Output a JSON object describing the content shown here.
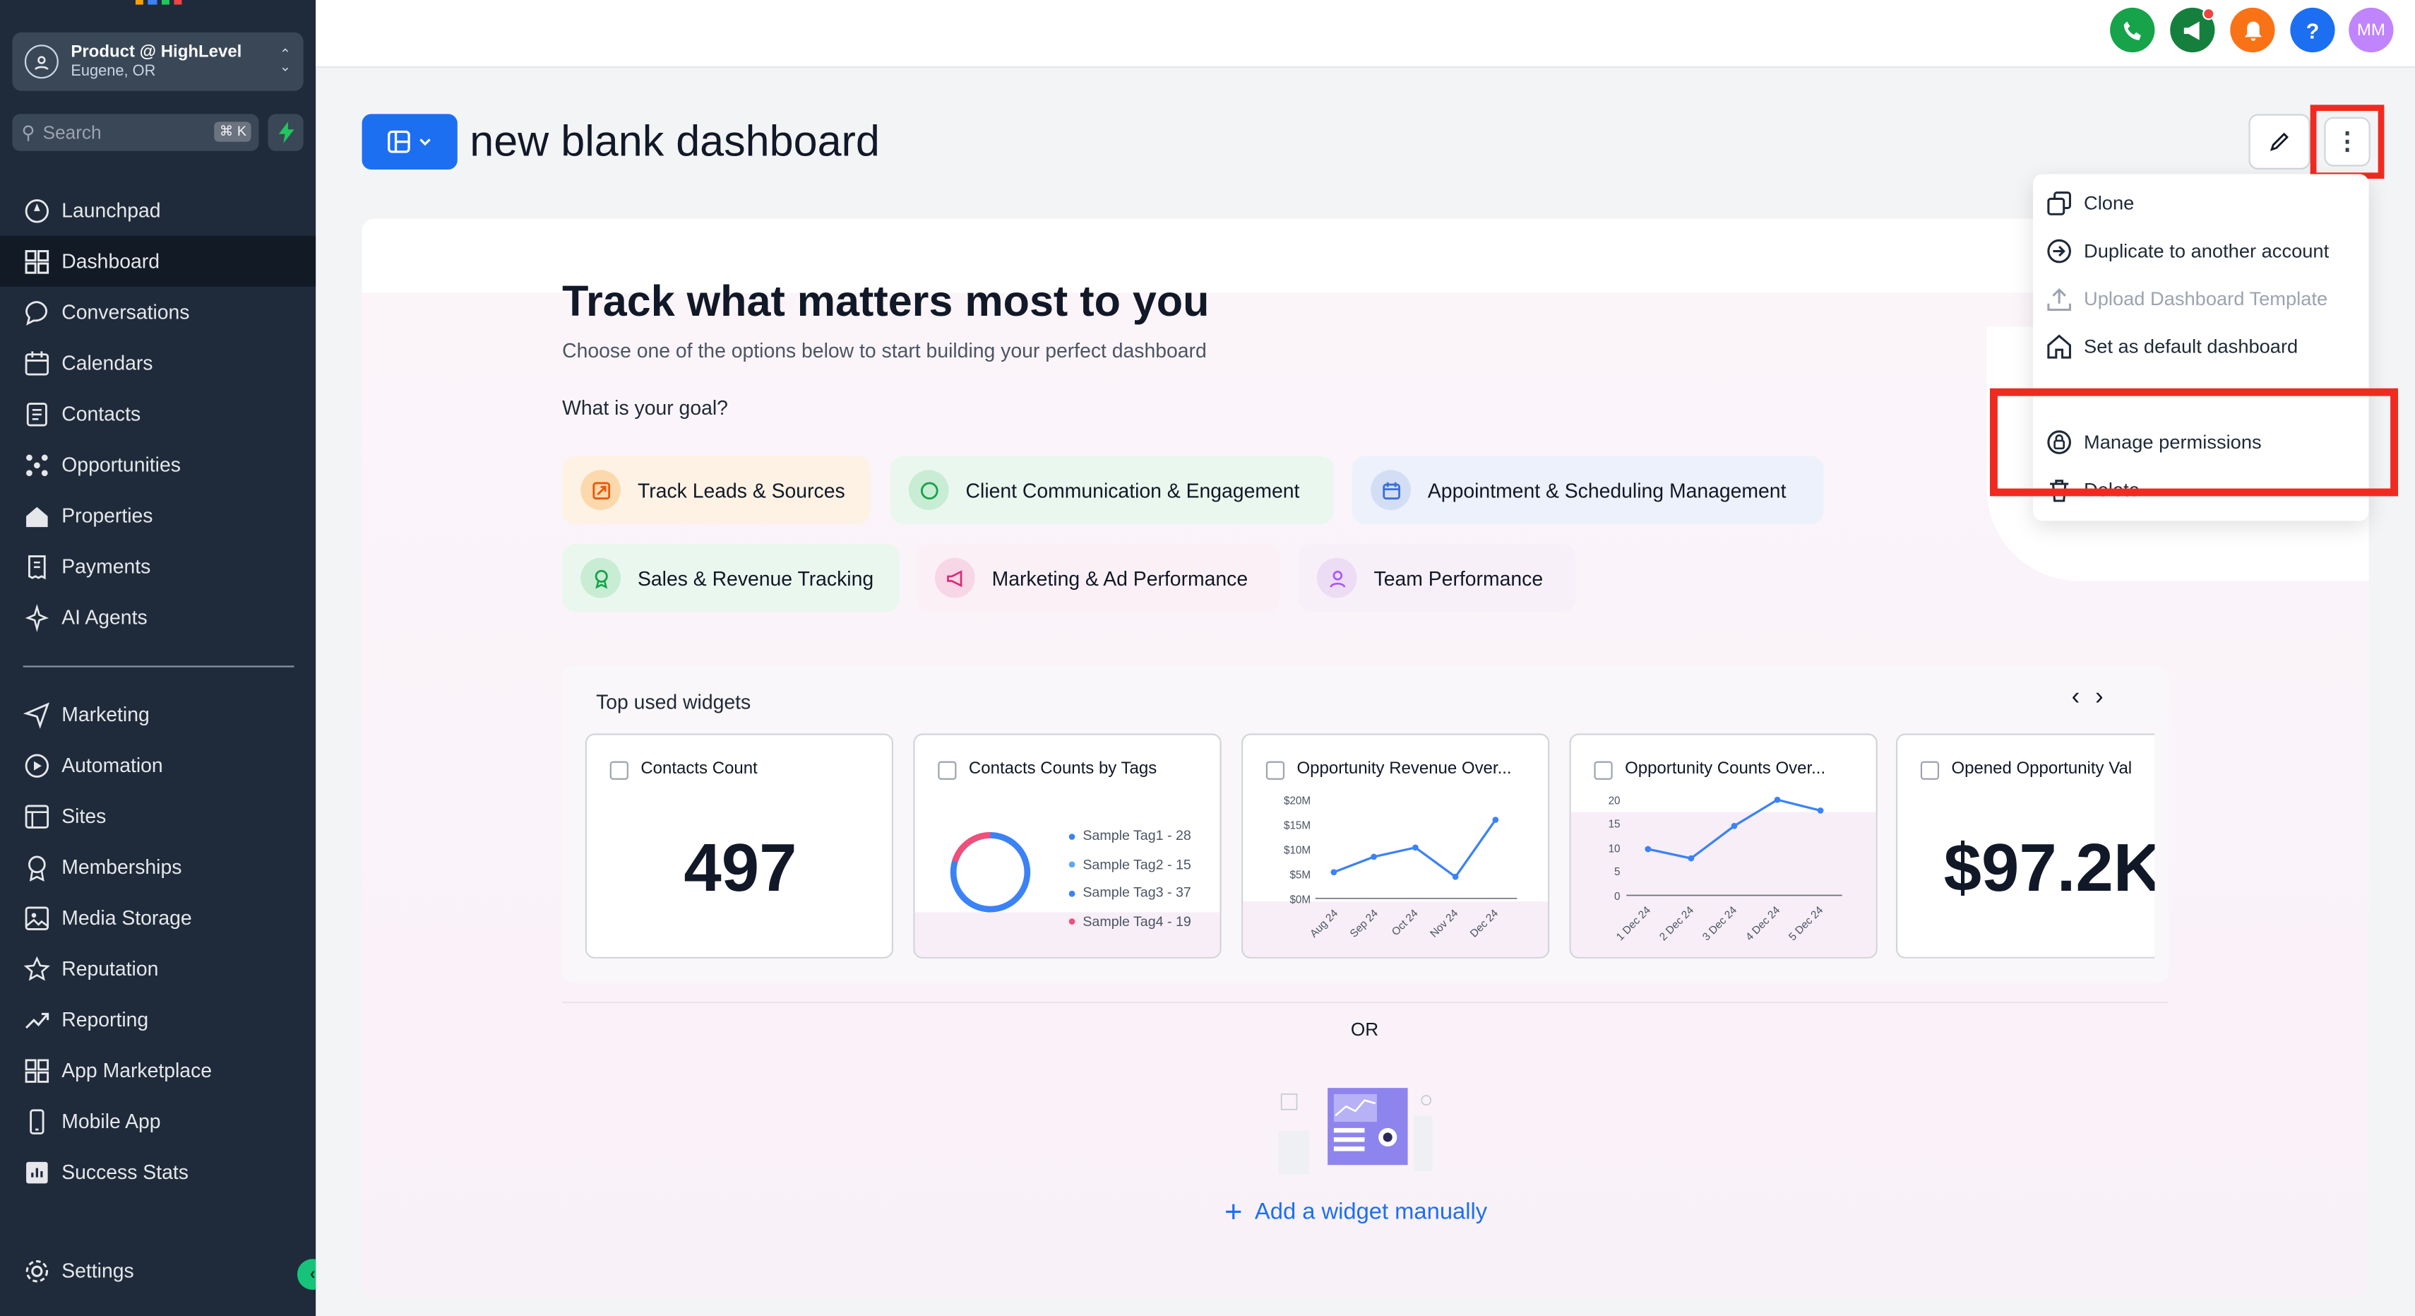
{
  "account": {
    "name": "Product @ HighLevel",
    "location": "Eugene, OR"
  },
  "search": {
    "placeholder": "Search",
    "shortcut": "⌘ K"
  },
  "sidebar": {
    "items": [
      {
        "label": "Launchpad",
        "icon": "rocket-icon"
      },
      {
        "label": "Dashboard",
        "icon": "grid-icon",
        "active": true
      },
      {
        "label": "Conversations",
        "icon": "chat-icon"
      },
      {
        "label": "Calendars",
        "icon": "calendar-icon"
      },
      {
        "label": "Contacts",
        "icon": "contacts-icon"
      },
      {
        "label": "Opportunities",
        "icon": "opportunities-icon"
      },
      {
        "label": "Properties",
        "icon": "home-icon"
      },
      {
        "label": "Payments",
        "icon": "receipt-icon"
      },
      {
        "label": "AI Agents",
        "icon": "sparkle-icon"
      }
    ],
    "items2": [
      {
        "label": "Marketing",
        "icon": "send-icon"
      },
      {
        "label": "Automation",
        "icon": "automation-icon"
      },
      {
        "label": "Sites",
        "icon": "sites-icon"
      },
      {
        "label": "Memberships",
        "icon": "award-icon"
      },
      {
        "label": "Media Storage",
        "icon": "image-icon"
      },
      {
        "label": "Reputation",
        "icon": "star-icon"
      },
      {
        "label": "Reporting",
        "icon": "trend-icon"
      },
      {
        "label": "App Marketplace",
        "icon": "apps-icon"
      },
      {
        "label": "Mobile App",
        "icon": "phone-icon"
      },
      {
        "label": "Success Stats",
        "icon": "stats-icon"
      }
    ],
    "settings": "Settings"
  },
  "topbar": {
    "avatar_initials": "MM",
    "help": "?"
  },
  "page": {
    "title": "new blank dashboard"
  },
  "hero": {
    "heading": "Track what matters most to you",
    "subheading": "Choose one of the options below to start building your perfect dashboard",
    "goal_question": "What is your goal?"
  },
  "goals": [
    {
      "label": "Track Leads & Sources"
    },
    {
      "label": "Client Communication & Engagement"
    },
    {
      "label": "Appointment & Scheduling Management"
    },
    {
      "label": "Sales & Revenue Tracking"
    },
    {
      "label": "Marketing & Ad Performance"
    },
    {
      "label": "Team Performance"
    }
  ],
  "widgets": {
    "title": "Top used widgets",
    "cards": [
      {
        "title": "Contacts Count",
        "value": "497"
      },
      {
        "title": "Contacts Counts by Tags",
        "legend": [
          "Sample Tag1 - 28",
          "Sample Tag2 - 15",
          "Sample Tag3 - 37",
          "Sample Tag4 - 19"
        ]
      },
      {
        "title": "Opportunity Revenue Over...",
        "yticks": [
          "$20M",
          "$15M",
          "$10M",
          "$5M",
          "$0M"
        ],
        "xticks": [
          "Aug 24",
          "Sep 24",
          "Oct 24",
          "Nov 24",
          "Dec 24"
        ]
      },
      {
        "title": "Opportunity Counts Over...",
        "yticks": [
          "20",
          "15",
          "10",
          "5",
          "0"
        ],
        "xticks": [
          "1 Dec 24",
          "2 Dec 24",
          "3 Dec 24",
          "4 Dec 24",
          "5 Dec 24"
        ]
      },
      {
        "title": "Opened Opportunity Val",
        "value": "$97.2K"
      }
    ]
  },
  "or_label": "OR",
  "add_widget": "Add a widget manually",
  "menu": {
    "items": [
      {
        "label": "Clone",
        "icon": "clone-icon"
      },
      {
        "label": "Duplicate to another account",
        "icon": "duplicate-icon"
      },
      {
        "label": "Upload Dashboard Template",
        "icon": "upload-icon",
        "disabled": true
      },
      {
        "label": "Set as default dashboard",
        "icon": "home-icon"
      },
      {
        "label": "Manage permissions",
        "icon": "lock-icon"
      },
      {
        "label": "Delete",
        "icon": "trash-icon"
      }
    ]
  },
  "colors": {
    "sidebar": "#1f2b3a",
    "accent": "#1d6ff2",
    "highlight": "#f02a20"
  }
}
